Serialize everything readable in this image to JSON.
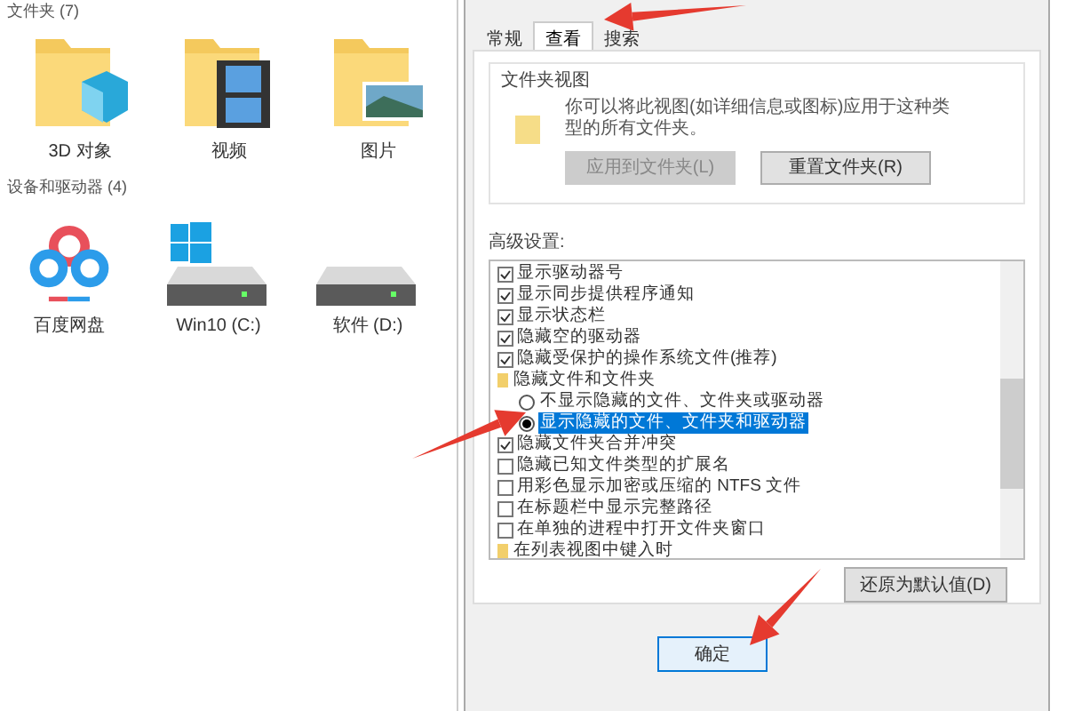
{
  "explorer": {
    "folders_header": "文件夹 (7)",
    "folders": [
      {
        "kind": "cube",
        "label": "3D 对象"
      },
      {
        "kind": "video",
        "label": "视频"
      },
      {
        "kind": "picture",
        "label": "图片"
      }
    ],
    "devices_header": "设备和驱动器 (4)",
    "devices": [
      {
        "kind": "cloud",
        "label": "百度网盘"
      },
      {
        "kind": "windows",
        "label": "Win10 (C:)"
      },
      {
        "kind": "drive",
        "label": "软件 (D:)"
      }
    ]
  },
  "dialog": {
    "tabs": [
      {
        "label": "常规",
        "selected": false
      },
      {
        "label": "查看",
        "selected": true
      },
      {
        "label": "搜索",
        "selected": false
      }
    ],
    "folder_views": {
      "title": "文件夹视图",
      "description": "你可以将此视图(如详细信息或图标)应用于这种类型的所有文件夹。",
      "buttons": [
        {
          "label": "应用到文件夹(L)",
          "disabled": true
        },
        {
          "label": "重置文件夹(R)",
          "disabled": false
        }
      ]
    },
    "advanced_label": "高级设置:",
    "settings": [
      {
        "kind": "checkbox",
        "label": "显示驱动器号",
        "checked": true
      },
      {
        "kind": "checkbox",
        "label": "显示同步提供程序通知",
        "checked": true
      },
      {
        "kind": "checkbox",
        "label": "显示状态栏",
        "checked": true
      },
      {
        "kind": "checkbox",
        "label": "隐藏空的驱动器",
        "checked": true
      },
      {
        "kind": "checkbox",
        "label": "隐藏受保护的操作系统文件(推荐)",
        "checked": true
      },
      {
        "kind": "folder",
        "label": "隐藏文件和文件夹",
        "children": [
          {
            "kind": "radio",
            "label": "不显示隐藏的文件、文件夹或驱动器",
            "selected": false
          },
          {
            "kind": "radio",
            "label": "显示隐藏的文件、文件夹和驱动器",
            "selected": true
          }
        ]
      },
      {
        "kind": "checkbox",
        "label": "隐藏文件夹合并冲突",
        "checked": true
      },
      {
        "kind": "checkbox",
        "label": "隐藏已知文件类型的扩展名",
        "checked": false
      },
      {
        "kind": "checkbox",
        "label": "用彩色显示加密或压缩的 NTFS 文件",
        "checked": false
      },
      {
        "kind": "checkbox",
        "label": "在标题栏中显示完整路径",
        "checked": false
      },
      {
        "kind": "checkbox",
        "label": "在单独的进程中打开文件夹窗口",
        "checked": false
      },
      {
        "kind": "folder",
        "label": "在列表视图中键入时"
      }
    ],
    "restore_button": "还原为默认值(D)",
    "ok_button": "确定"
  }
}
